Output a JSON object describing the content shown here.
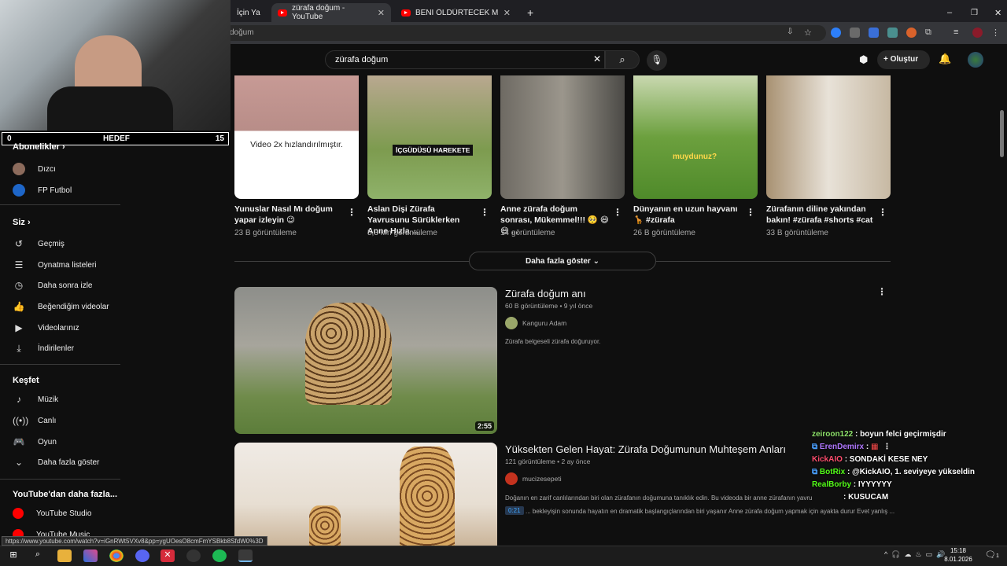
{
  "browser": {
    "tabs": [
      {
        "label": "İçin Ya"
      },
      {
        "label": "zürafa doğum - YouTube",
        "active": true
      },
      {
        "label": "BENİ ÖLDÜRTECEK MİSİN! Türk"
      }
    ],
    "url_partial": "doğum"
  },
  "youtube": {
    "search_query": "zürafa doğum",
    "create_label": "Oluştur"
  },
  "stream_goal": {
    "left": "0",
    "label": "HEDEF",
    "right": "15"
  },
  "sidebar": {
    "subscriptions_title": "Abonelikler",
    "subscriptions": [
      {
        "label": "Dızcı"
      },
      {
        "label": "FP Futbol"
      }
    ],
    "you_title": "Siz",
    "you_items": [
      {
        "label": "Geçmiş",
        "icon": "history-icon"
      },
      {
        "label": "Oynatma listeleri",
        "icon": "playlist-icon"
      },
      {
        "label": "Daha sonra izle",
        "icon": "clock-icon"
      },
      {
        "label": "Beğendiğim videolar",
        "icon": "like-icon"
      },
      {
        "label": "Videolarınız",
        "icon": "video-icon"
      },
      {
        "label": "İndirilenler",
        "icon": "download-icon"
      }
    ],
    "explore_title": "Keşfet",
    "explore_items": [
      {
        "label": "Müzik",
        "icon": "music-icon"
      },
      {
        "label": "Canlı",
        "icon": "live-icon"
      },
      {
        "label": "Oyun",
        "icon": "gaming-icon"
      },
      {
        "label": "Daha fazla göster",
        "icon": "chevron-down-icon"
      }
    ],
    "more_title": "YouTube'dan daha fazla...",
    "more_items": [
      {
        "label": "YouTube Studio"
      },
      {
        "label": "YouTube Music"
      }
    ]
  },
  "shorts": [
    {
      "title": "Yunuslar Nasıl Mı doğum yapar izleyin 😉",
      "views": "23 B görüntüleme",
      "overlay": "Video 2x hızlandırılmıştır."
    },
    {
      "title": "Aslan Dişi Zürafa Yavrusunu Sürüklerken Anne Hızla ...",
      "views": "5,3 Mn görüntüleme",
      "overlay": "İÇGÜDÜSÜ HAREKETE"
    },
    {
      "title": "Anne zürafa doğum sonrası, Mükemmel!!! 🥺 😄 😄 ...",
      "views": "14 görüntüleme",
      "overlay": ""
    },
    {
      "title": "Dünyanın en uzun hayvanı 🦒 #zürafa",
      "views": "26 B görüntüleme",
      "overlay": "muydunuz?"
    },
    {
      "title": "Zürafanın diline yakından bakın! #zürafa #shorts #cat",
      "views": "33 B görüntüleme",
      "overlay": ""
    }
  ],
  "more_button": "Daha fazla göster",
  "videos": [
    {
      "title": "Zürafa doğum anı",
      "meta": "60 B görüntüleme • 9 yıl önce",
      "channel": "Kanguru Adam",
      "description": "Zürafa belgeseli zürafa doğuruyor.",
      "duration": "2:55"
    },
    {
      "title": "Yüksekten Gelen Hayat: Zürafa Doğumunun Muhteşem Anları",
      "meta": "121 görüntüleme • 2 ay önce",
      "channel": "mucizesepeti",
      "description": "Doğanın en zarif canlılarından biri olan zürafanın doğumuna tanıklık edin. Bu videoda bir anne zürafanın yavrus",
      "chapter_time": "0:21",
      "chapter_text": "... bekleyişin sonunda hayatın en dramatik başlangıçlarından biri yaşanır Anne zürafa doğum yapmak için ayakta durur Evet yanlış ..."
    }
  ],
  "chat": [
    {
      "user": "zeiroon122",
      "msg": ": boyun felci geçirmişdir",
      "color": "#8fe36b"
    },
    {
      "user": "ErenDemirx",
      "msg": ":",
      "color": "#b077ff"
    },
    {
      "user": "KickAIO",
      "msg": ": SONDAKİ KESE NEY",
      "color": "#ff4d6d"
    },
    {
      "user": "BotRix",
      "msg": ": @KickAIO, 1. seviyeye yükseldin",
      "color": "#53fc18"
    },
    {
      "user": "RealBorby",
      "msg": ": IYYYYYY",
      "color": "#53fc18"
    },
    {
      "user": "",
      "msg": ": KUSUCAM",
      "color": "#ff4d6d"
    }
  ],
  "status_url": "https://www.youtube.com/watch?v=iGnRWt5VXv8&pp=ygUOesO8cmFmYSBkb8SfdW0%3D",
  "clock": {
    "time": "15:18",
    "date": "8.01.2026"
  },
  "notification_count": "1"
}
